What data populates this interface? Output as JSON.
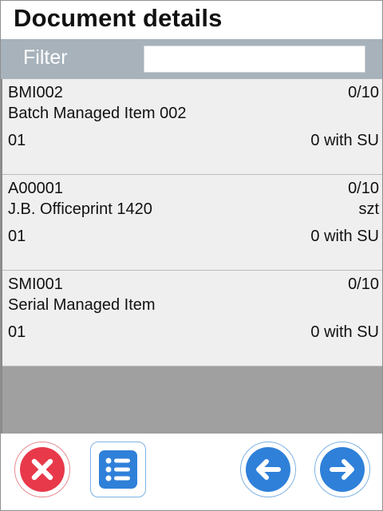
{
  "header": {
    "title": "Document details"
  },
  "filter": {
    "label": "Filter",
    "value": ""
  },
  "items": [
    {
      "code": "BMI002",
      "qty": "0/10",
      "name": "Batch Managed Item 002",
      "unit": "",
      "location": "01",
      "su": "0 with SU"
    },
    {
      "code": "A00001",
      "qty": "0/10",
      "name": "J.B. Officeprint 1420",
      "unit": "szt",
      "location": "01",
      "su": "0 with SU"
    },
    {
      "code": "SMI001",
      "qty": "0/10",
      "name": "Serial Managed Item",
      "unit": "",
      "location": "01",
      "su": "0 with SU"
    }
  ],
  "toolbar": {
    "cancel_icon": "close-icon",
    "list_icon": "list-icon",
    "back_icon": "arrow-left-icon",
    "next_icon": "arrow-right-icon"
  },
  "colors": {
    "filter_bar": "#a7b2bb",
    "list_bg": "#a0a0a0",
    "item_bg": "#efefef",
    "danger": "#e8394a",
    "primary": "#2f80d9"
  }
}
